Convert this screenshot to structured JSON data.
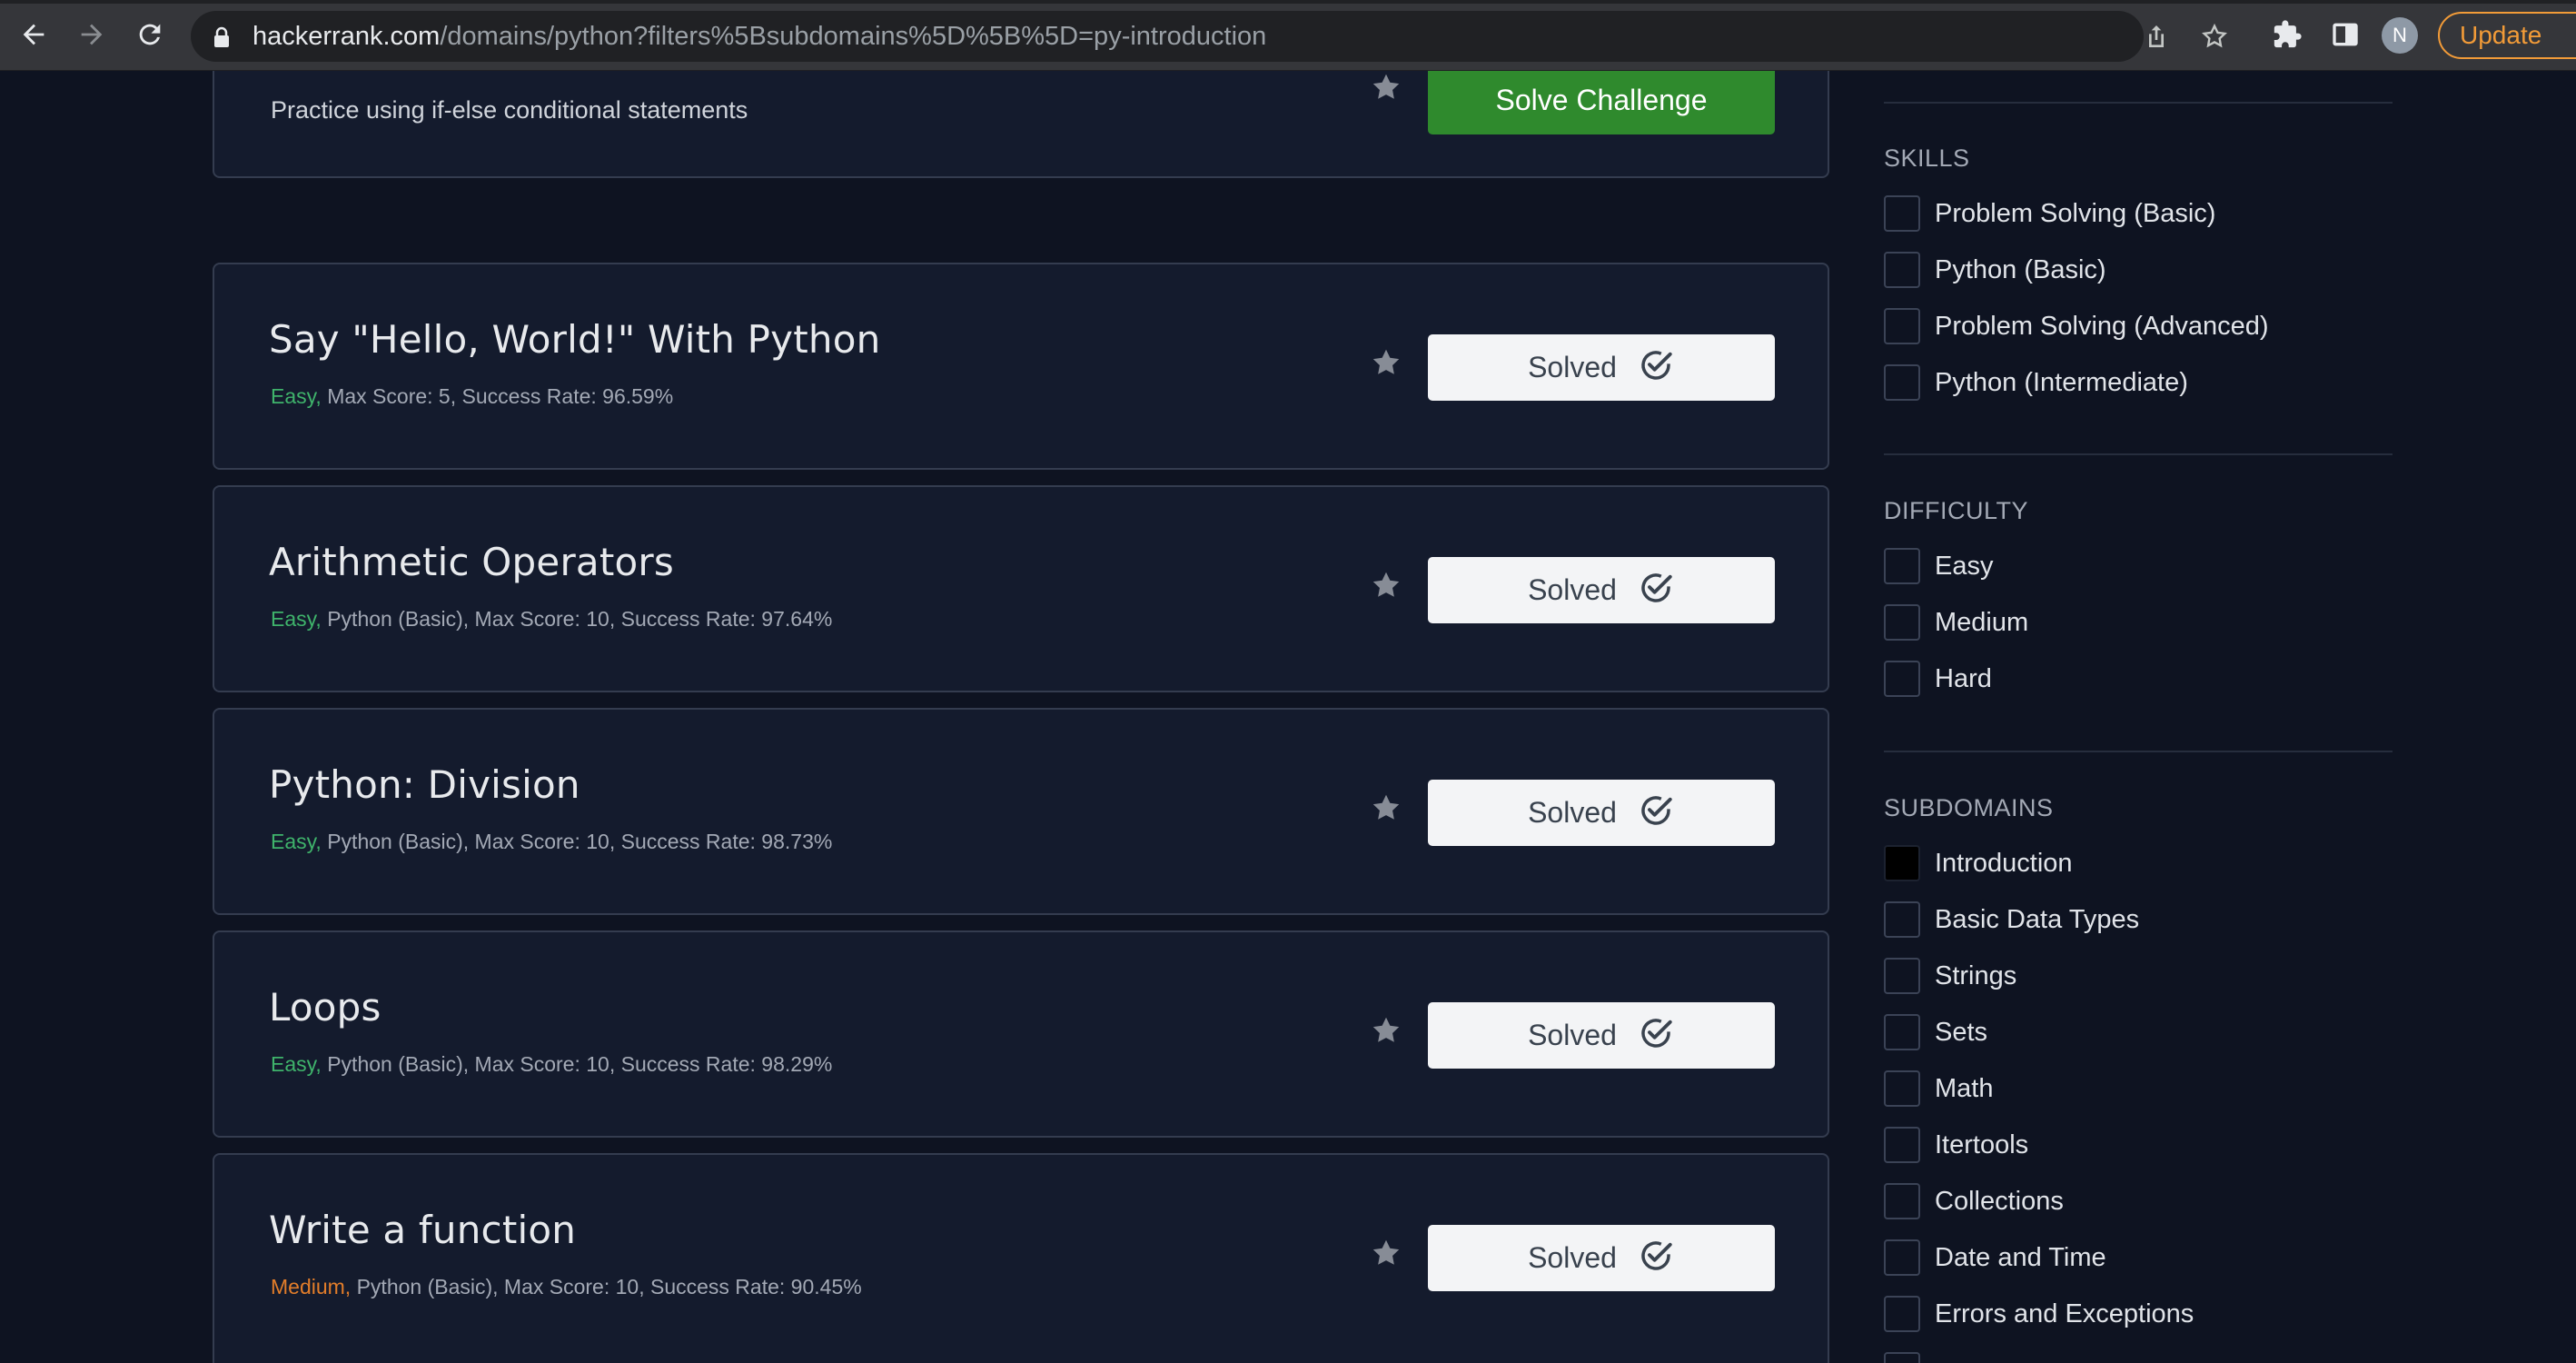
{
  "browser": {
    "url_host": "hackerrank.com",
    "url_path": "/domains/python?filters%5Bsubdomains%5D%5B%5D=py-introduction",
    "profile_initial": "N",
    "update_label": "Update",
    "icons": [
      "back-arrow-icon",
      "forward-arrow-icon",
      "reload-icon",
      "lock-icon",
      "share-icon",
      "bookmark-star-icon",
      "extensions-icon",
      "side-panel-icon"
    ]
  },
  "challenges": [
    {
      "title": "",
      "description": "Practice using if-else conditional statements",
      "action": "Solve Challenge",
      "status": "unsolved"
    },
    {
      "title": "Say \"Hello, World!\" With Python",
      "difficulty": "Easy,",
      "meta": " Max Score: 5, Success Rate: 96.59%",
      "action": "Solved",
      "status": "solved"
    },
    {
      "title": "Arithmetic Operators",
      "difficulty": "Easy,",
      "meta": " Python (Basic), Max Score: 10, Success Rate: 97.64%",
      "action": "Solved",
      "status": "solved"
    },
    {
      "title": "Python: Division",
      "difficulty": "Easy,",
      "meta": " Python (Basic), Max Score: 10, Success Rate: 98.73%",
      "action": "Solved",
      "status": "solved"
    },
    {
      "title": "Loops",
      "difficulty": "Easy,",
      "meta": " Python (Basic), Max Score: 10, Success Rate: 98.29%",
      "action": "Solved",
      "status": "solved"
    },
    {
      "title": "Write a function",
      "difficulty": "Medium,",
      "meta": " Python (Basic), Max Score: 10, Success Rate: 90.45%",
      "action": "Solved",
      "status": "solved"
    }
  ],
  "sidebar": {
    "skills": {
      "title": "SKILLS",
      "items": [
        "Problem Solving (Basic)",
        "Python (Basic)",
        "Problem Solving (Advanced)",
        "Python (Intermediate)"
      ]
    },
    "difficulty": {
      "title": "DIFFICULTY",
      "items": [
        "Easy",
        "Medium",
        "Hard"
      ]
    },
    "subdomains": {
      "title": "SUBDOMAINS",
      "items": [
        "Introduction",
        "Basic Data Types",
        "Strings",
        "Sets",
        "Math",
        "Itertools",
        "Collections",
        "Date and Time",
        "Errors and Exceptions"
      ],
      "checked": "Introduction"
    }
  },
  "colors": {
    "page_bg": "#0e1321",
    "card_bg": "#141b2d",
    "easy": "#3fb36b",
    "medium": "#e27d2a",
    "solve_button": "#2f8a2d",
    "update_accent": "#f29b38"
  }
}
